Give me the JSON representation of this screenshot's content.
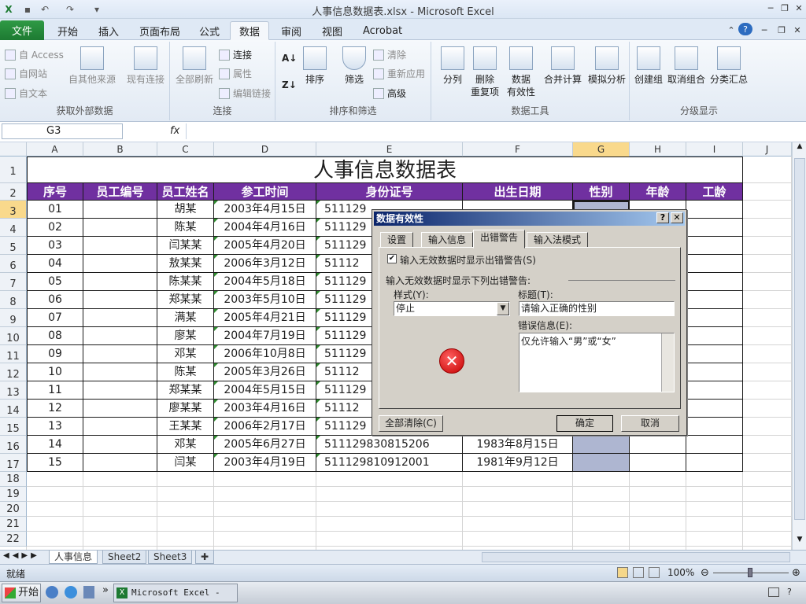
{
  "window": {
    "title": "人事信息数据表.xlsx - Microsoft Excel"
  },
  "tabs": [
    "文件",
    "开始",
    "插入",
    "页面布局",
    "公式",
    "数据",
    "审阅",
    "视图",
    "Acrobat"
  ],
  "ribbon": {
    "get_external": {
      "access": "自 Access",
      "web": "自网站",
      "text": "自文本",
      "other": "自其他来源",
      "existing": "现有连接",
      "label": "获取外部数据"
    },
    "connections": {
      "refresh": "全部刷新",
      "conn": "连接",
      "props": "属性",
      "edit_links": "编辑链接",
      "label": "连接"
    },
    "sort_filter": {
      "sort": "排序",
      "filter": "筛选",
      "clear": "清除",
      "reapply": "重新应用",
      "advanced": "高级",
      "label": "排序和筛选"
    },
    "data_tools": {
      "split": "分列",
      "remove_dup": "删除\n重复项",
      "validation": "数据\n有效性",
      "consolidate": "合并计算",
      "whatif": "模拟分析",
      "label": "数据工具"
    },
    "outline": {
      "group": "创建组",
      "ungroup": "取消组合",
      "subtotal": "分类汇总",
      "label": "分级显示"
    }
  },
  "formula_bar": {
    "cell_ref": "G3",
    "fx": "fx",
    "value": ""
  },
  "columns": [
    "A",
    "B",
    "C",
    "D",
    "E",
    "F",
    "G",
    "H",
    "I",
    "J"
  ],
  "sheet": {
    "title": "人事信息数据表",
    "headers": [
      "序号",
      "员工编号",
      "员工姓名",
      "参工时间",
      "身份证号",
      "出生日期",
      "性别",
      "年龄",
      "工龄"
    ],
    "rows": [
      [
        "01",
        "",
        "胡某",
        "2003年4月15日",
        "511129",
        "",
        ""
      ],
      [
        "02",
        "",
        "陈某",
        "2004年4月16日",
        "511129",
        "",
        ""
      ],
      [
        "03",
        "",
        "闫某某",
        "2005年4月20日",
        "511129",
        "",
        ""
      ],
      [
        "04",
        "",
        "敖某某",
        "2006年3月12日",
        "51112",
        "",
        ""
      ],
      [
        "05",
        "",
        "陈某某",
        "2004年5月18日",
        "511129",
        "",
        ""
      ],
      [
        "06",
        "",
        "郑某某",
        "2003年5月10日",
        "511129",
        "",
        ""
      ],
      [
        "07",
        "",
        "满某",
        "2005年4月21日",
        "511129",
        "",
        ""
      ],
      [
        "08",
        "",
        "廖某",
        "2004年7月19日",
        "511129",
        "",
        ""
      ],
      [
        "09",
        "",
        "邓某",
        "2006年10月8日",
        "511129",
        "",
        ""
      ],
      [
        "10",
        "",
        "陈某",
        "2005年3月26日",
        "51112",
        "",
        ""
      ],
      [
        "11",
        "",
        "郑某某",
        "2004年5月15日",
        "511129",
        "",
        ""
      ],
      [
        "12",
        "",
        "廖某某",
        "2003年4月16日",
        "51112",
        "",
        ""
      ],
      [
        "13",
        "",
        "王某某",
        "2006年2月17日",
        "511129",
        "",
        ""
      ],
      [
        "14",
        "",
        "邓某",
        "2005年6月27日",
        "511129830815206",
        "1983年8月15日",
        ""
      ],
      [
        "15",
        "",
        "闫某",
        "2003年4月19日",
        "511129810912001",
        "1981年9月12日",
        ""
      ]
    ],
    "row_numbers": [
      "1",
      "2",
      "3",
      "4",
      "5",
      "6",
      "7",
      "8",
      "9",
      "10",
      "11",
      "12",
      "13",
      "14",
      "15",
      "16",
      "17",
      "18",
      "19",
      "20",
      "21",
      "22"
    ]
  },
  "sheet_tabs": [
    "人事信息",
    "Sheet2",
    "Sheet3"
  ],
  "status": {
    "ready": "就绪",
    "zoom": "100%"
  },
  "taskbar": {
    "start": "开始",
    "app": "Microsoft Excel - ..."
  },
  "dialog": {
    "title": "数据有效性",
    "tabs": [
      "设置",
      "输入信息",
      "出错警告",
      "输入法模式"
    ],
    "show_alert": "输入无效数据时显示出错警告(S)",
    "section": "输入无效数据时显示下列出错警告:",
    "style_label": "样式(Y):",
    "style_value": "停止",
    "title_label": "标题(T):",
    "title_value": "请输入正确的性别",
    "message_label": "错误信息(E):",
    "message_value": "仅允许输入“男”或“女”",
    "clear_all": "全部清除(C)",
    "ok": "确定",
    "cancel": "取消"
  }
}
